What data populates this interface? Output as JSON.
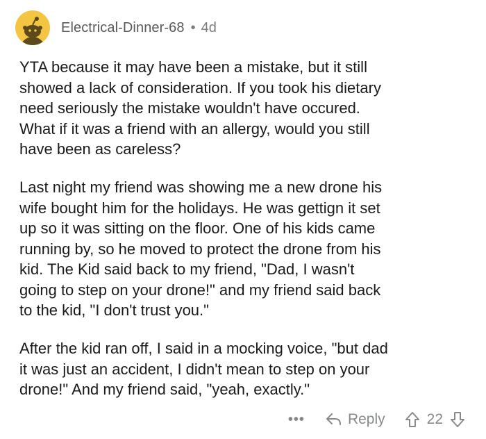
{
  "comment": {
    "author": "Electrical-Dinner-68",
    "separator": "•",
    "age": "4d",
    "paragraphs": [
      "YTA because it may have been a mistake, but it still\nshowed a lack of consideration. If you took his dietary\nneed seriously the mistake wouldn't have occured.\nWhat if it was a friend with an allergy, would you still\nhave been as careless?",
      "Last night my friend was showing me a new drone his\nwife bought him for the holidays. He was gettign it set\nup so it was sitting on the floor. One of his kids came\nrunning by, so he moved to protect the drone from his\nkid. The Kid said back to my friend, \"Dad, I wasn't\ngoing to step on your drone!\" and my friend said back\nto the kid, \"I don't trust you.\"",
      "After the kid ran off, I said in a mocking voice, \"but dad\nit was just an accident,  I didn't mean to step on your\ndrone!\" And my friend said, \"yeah, exactly.\""
    ],
    "actions": {
      "more_label": "•••",
      "reply_label": "Reply",
      "score": "22"
    }
  },
  "colors": {
    "avatar_bg": "#f4c542",
    "meta_text": "#7c7c7c",
    "body_text": "#1a1a1b",
    "action_text": "#878a8c"
  },
  "icons": [
    "snoo-avatar-icon",
    "reply-arrow-icon",
    "upvote-arrow-icon",
    "downvote-arrow-icon"
  ]
}
